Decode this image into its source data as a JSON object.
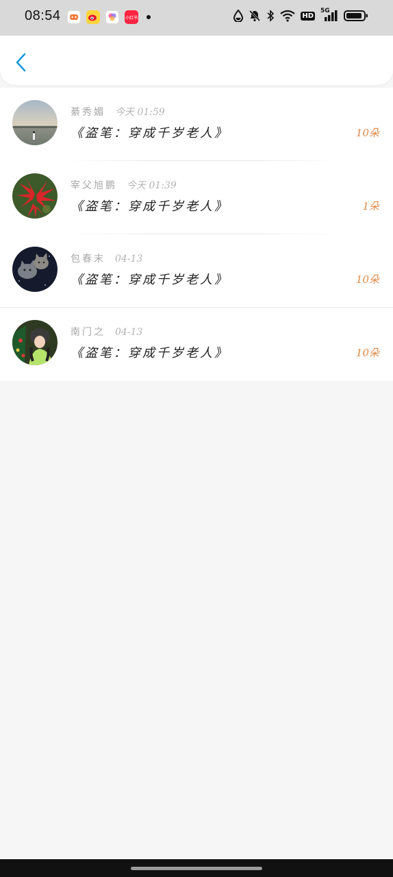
{
  "status_bar": {
    "time": "08:54",
    "notification_icons": [
      "game-center-icon",
      "weibo-icon",
      "photos-icon",
      "xiaohongshu-icon"
    ],
    "xhs_label": "小红书",
    "system_icons": [
      "drop-icon",
      "mute-bell-icon",
      "bluetooth-icon",
      "wifi-icon",
      "hd-icon",
      "5g-signal-icon",
      "battery-icon"
    ],
    "hd_label": "HD",
    "signal_label": "5G"
  },
  "header": {
    "back_icon": "chevron-left-icon",
    "accent_color": "#1a9ad9"
  },
  "items": [
    {
      "author": "綦秀媚",
      "time": "今天 01:59",
      "title": "《盗笔：穿成千岁老人》",
      "count": "10朵"
    },
    {
      "author": "宰父旭鹏",
      "time": "今天 01:39",
      "title": "《盗笔：穿成千岁老人》",
      "count": "1朵"
    },
    {
      "author": "包春末",
      "time": "04-13",
      "title": "《盗笔：穿成千岁老人》",
      "count": "10朵"
    },
    {
      "author": "南门之",
      "time": "04-13",
      "title": "《盗笔：穿成千岁老人》",
      "count": "10朵"
    }
  ],
  "colors": {
    "count": "#e0894a",
    "meta": "#a8a8a8",
    "title": "#222222",
    "background": "#f7f6f6"
  }
}
